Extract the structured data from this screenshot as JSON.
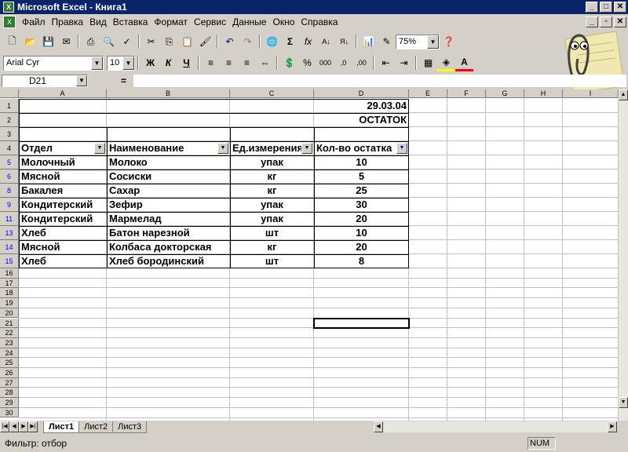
{
  "window": {
    "title": "Microsoft Excel - Книга1"
  },
  "menu": [
    "Файл",
    "Правка",
    "Вид",
    "Вставка",
    "Формат",
    "Сервис",
    "Данные",
    "Окно",
    "Справка"
  ],
  "toolbar": {
    "zoom": "75%",
    "font_name": "Arial Cyr",
    "font_size": "10"
  },
  "formula_bar": {
    "name_box": "D21",
    "eq": "="
  },
  "columns": [
    "A",
    "B",
    "C",
    "D",
    "E",
    "F",
    "G",
    "H",
    "I"
  ],
  "rows": [
    "1",
    "2",
    "3",
    "4",
    "5",
    "6",
    "8",
    "9",
    "11",
    "13",
    "14",
    "15",
    "16",
    "17",
    "18",
    "19",
    "20",
    "21",
    "22",
    "23",
    "24",
    "25",
    "26",
    "27",
    "28",
    "29",
    "30"
  ],
  "cells": {
    "d1": "29.03.04",
    "d2": "ОСТАТОК",
    "headers": [
      "Отдел",
      "Наименование",
      "Ед.измерения",
      "Кол-во остатка"
    ],
    "data": [
      [
        "Молочный",
        "Молоко",
        "упак",
        "10"
      ],
      [
        "Мясной",
        "Сосиски",
        "кг",
        "5"
      ],
      [
        "Бакалея",
        "Сахар",
        "кг",
        "25"
      ],
      [
        "Кондитерский",
        "Зефир",
        "упак",
        "30"
      ],
      [
        "Кондитерский",
        "Мармелад",
        "упак",
        "20"
      ],
      [
        "Хлеб",
        "Батон нарезной",
        "шт",
        "10"
      ],
      [
        "Мясной",
        "Колбаса докторская",
        "кг",
        "20"
      ],
      [
        "Хлеб",
        "Хлеб бородинский",
        "шт",
        "8"
      ]
    ]
  },
  "sheets": [
    "Лист1",
    "Лист2",
    "Лист3"
  ],
  "status": {
    "text": "Фильтр: отбор",
    "num": "NUM"
  }
}
